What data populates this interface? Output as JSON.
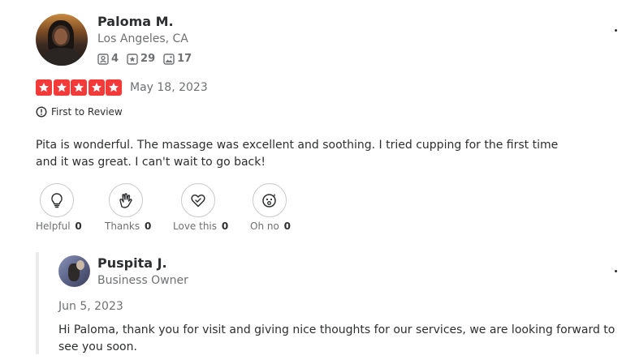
{
  "reviewer": {
    "name": "Paloma M.",
    "location": "Los Angeles, CA",
    "stats": {
      "friends": "4",
      "reviews": "29",
      "photos": "17"
    }
  },
  "review": {
    "rating": 5,
    "date": "May 18, 2023",
    "badge": "First to Review",
    "text": "Pita is wonderful. The massage was excellent and soothing. I tried cupping for the first time and it was great. I can't wait to go back!"
  },
  "reactions": [
    {
      "icon": "lightbulb-icon",
      "label": "Helpful",
      "count": "0"
    },
    {
      "icon": "clapping-hands-icon",
      "label": "Thanks",
      "count": "0"
    },
    {
      "icon": "heart-icon",
      "label": "Love this",
      "count": "0"
    },
    {
      "icon": "surprised-face-icon",
      "label": "Oh no",
      "count": "0"
    }
  ],
  "owner_reply": {
    "name": "Puspita J.",
    "role": "Business Owner",
    "date": "Jun 5, 2023",
    "text": "Hi Paloma, thank you for visit and giving nice thoughts for our services, we are looking forward to see you soon."
  },
  "colors": {
    "star_red": "#f43939",
    "text": "#2d2e2f",
    "muted": "#6e7072"
  }
}
